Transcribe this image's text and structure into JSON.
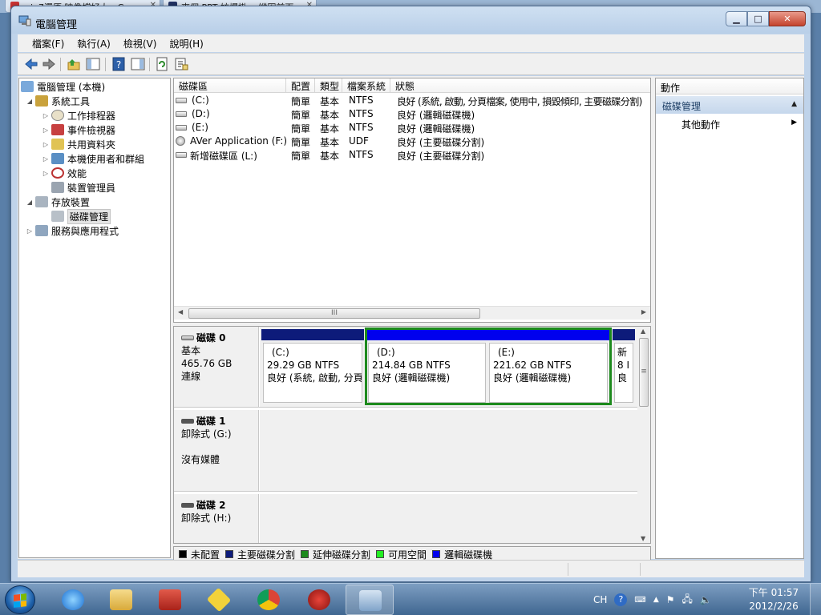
{
  "browser_tabs": [
    {
      "label": "win7還原 映像擋好大 - Go..."
    },
    {
      "label": "來個 PPT 妨爆掛 :: 縱圈前面"
    }
  ],
  "window": {
    "title": "電腦管理",
    "min_glyph": "▁",
    "max_glyph": "□",
    "close_glyph": "✕"
  },
  "menu": [
    "檔案(F)",
    "執行(A)",
    "檢視(V)",
    "說明(H)"
  ],
  "toolbar_icons": [
    "back-arrow-icon",
    "forward-arrow-icon",
    "up-folder-icon",
    "show-hide-tree-icon",
    "help-icon",
    "properties-icon",
    "refresh-icon",
    "export-list-icon"
  ],
  "tree": {
    "root": "電腦管理 (本機)",
    "system_tools": "系統工具",
    "task_scheduler": "工作排程器",
    "event_viewer": "事件檢視器",
    "shared_folders": "共用資料夾",
    "local_users": "本機使用者和群組",
    "performance": "效能",
    "device_manager": "裝置管理員",
    "storage": "存放裝置",
    "disk_management": "磁碟管理",
    "services": "服務與應用程式"
  },
  "volume_list": {
    "columns": [
      "磁碟區",
      "配置",
      "類型",
      "檔案系統",
      "狀態"
    ],
    "rows": [
      {
        "name": "(C:)",
        "layout": "簡單",
        "type": "基本",
        "fs": "NTFS",
        "status": "良好 (系統, 啟動, 分頁檔案, 使用中, 損毀傾印, 主要磁碟分割)"
      },
      {
        "name": "(D:)",
        "layout": "簡單",
        "type": "基本",
        "fs": "NTFS",
        "status": "良好 (邏輯磁碟機)"
      },
      {
        "name": "(E:)",
        "layout": "簡單",
        "type": "基本",
        "fs": "NTFS",
        "status": "良好 (邏輯磁碟機)"
      },
      {
        "name": "AVer Application (F:)",
        "layout": "簡單",
        "type": "基本",
        "fs": "UDF",
        "status": "良好 (主要磁碟分割)"
      },
      {
        "name": "新增磁碟區 (L:)",
        "layout": "簡單",
        "type": "基本",
        "fs": "NTFS",
        "status": "良好 (主要磁碟分割)"
      }
    ],
    "scroll_grip": "III"
  },
  "disks": {
    "disk0": {
      "name": "磁碟 0",
      "type": "基本",
      "size": "465.76 GB",
      "status": "連線",
      "partitions": [
        {
          "label": "(C:)",
          "size": "29.29 GB NTFS",
          "status": "良好 (系統, 啟動, 分頁",
          "color": "#0d1b7a"
        },
        {
          "label": "(D:)",
          "size": "214.84 GB NTFS",
          "status": "良好 (邏輯磁碟機)",
          "color": "#0000ee"
        },
        {
          "label": "(E:)",
          "size": "221.62 GB NTFS",
          "status": "良好 (邏輯磁碟機)",
          "color": "#0000ee"
        },
        {
          "label": "新",
          "size": "8 I",
          "status": "良",
          "color": "#0d1b7a"
        }
      ]
    },
    "disk1": {
      "name": "磁碟 1",
      "type": "卸除式 (G:)",
      "media": "沒有媒體"
    },
    "disk2": {
      "name": "磁碟 2",
      "type": "卸除式 (H:)"
    },
    "scroll_grip": "≡"
  },
  "legend": [
    {
      "label": "未配置",
      "color": "#000000"
    },
    {
      "label": "主要磁碟分割",
      "color": "#0d1b7a"
    },
    {
      "label": "延伸磁碟分割",
      "color": "#1d8a1d"
    },
    {
      "label": "可用空間",
      "color": "#22ee22"
    },
    {
      "label": "邏輯磁碟機",
      "color": "#0000ee"
    }
  ],
  "actions": {
    "header": "動作",
    "section": "磁碟管理",
    "more": "其他動作"
  },
  "taskbar": {
    "apps": [
      "internet-explorer-icon",
      "file-explorer-icon",
      "pdf-reader-icon",
      "media-player-icon",
      "chrome-icon",
      "red-app-icon",
      "computer-management-icon"
    ],
    "tray": {
      "ime": "CH",
      "help": "?"
    },
    "clock_time": "下午 01:57",
    "clock_date": "2012/2/26"
  }
}
